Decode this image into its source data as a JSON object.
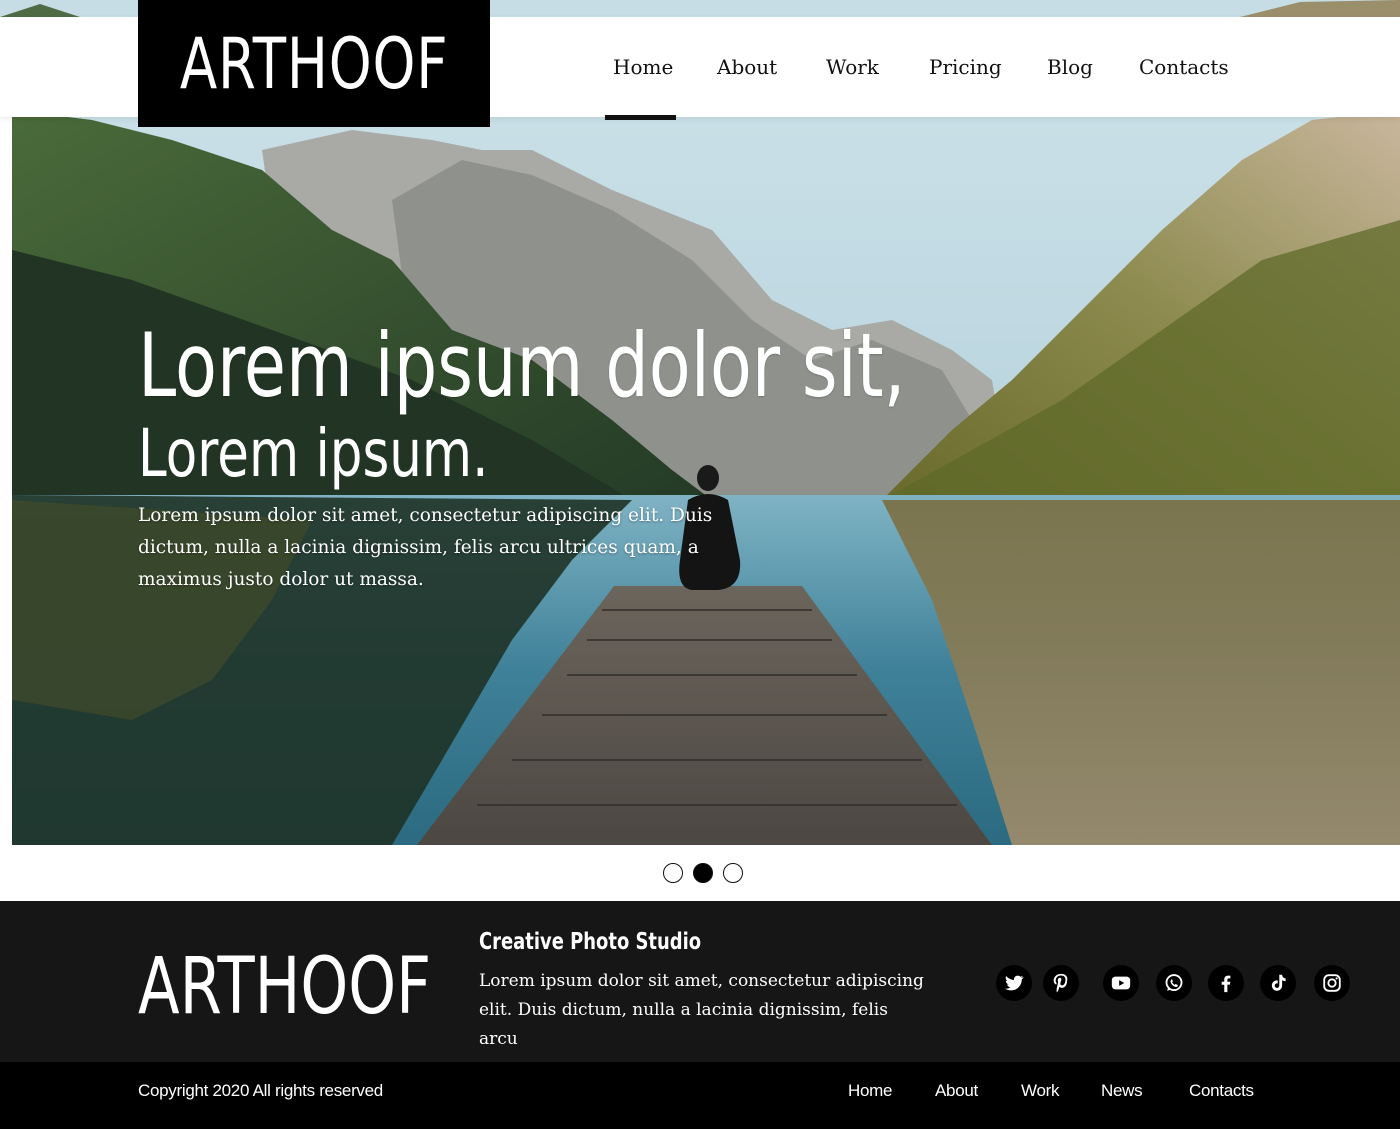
{
  "colors": {
    "header_bg": "#ffffff",
    "logo_bg": "#000000",
    "nav_text": "#111111",
    "footer_bg": "#161616",
    "footer_bottom_bg": "#000000",
    "text_light": "#ffffff"
  },
  "header": {
    "logo": "ARTHOOF",
    "nav": [
      {
        "label": "Home",
        "active": true
      },
      {
        "label": "About",
        "active": false
      },
      {
        "label": "Work",
        "active": false
      },
      {
        "label": "Pricing",
        "active": false
      },
      {
        "label": "Blog",
        "active": false
      },
      {
        "label": "Contacts",
        "active": false
      }
    ]
  },
  "hero": {
    "title": "Lorem ipsum dolor sit,",
    "subtitle": "Lorem ipsum.",
    "body": "Lorem ipsum dolor sit amet, consectetur adipiscing elit. Duis dictum, nulla a lacinia dignissim, felis arcu ultrices quam, a maximus justo dolor ut massa.",
    "image": "mountain-lake-pier-photo"
  },
  "slider": {
    "count": 3,
    "active_index": 1
  },
  "footer": {
    "logo": "ARTHOOF",
    "studio_title": "Creative Photo Studio",
    "description": "Lorem ipsum dolor sit amet, consectetur adipiscing elit. Duis dictum, nulla a lacinia dignissim, felis arcu",
    "social_icons": [
      "twitter-icon",
      "pinterest-icon",
      "youtube-icon",
      "whatsapp-icon",
      "facebook-icon",
      "tiktok-icon",
      "instagram-icon"
    ],
    "copyright": "Copyright 2020 All rights reserved",
    "nav": [
      "Home",
      "About",
      "Work",
      "News",
      "Contacts"
    ]
  }
}
